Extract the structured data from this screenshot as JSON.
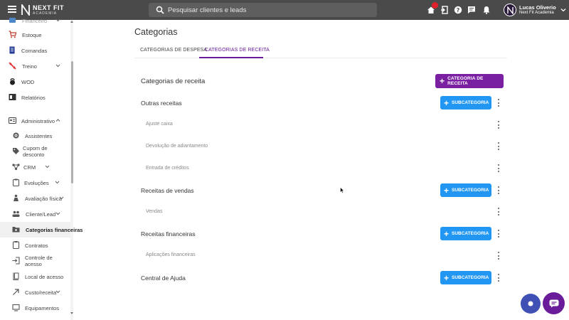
{
  "topbar": {
    "logo_line1": "NEXT FIT",
    "logo_line2": "ACADEMIA",
    "search_placeholder": "Pesquisar clientes e leads",
    "user_name": "Lucas Oliverio",
    "user_org": "Next Fit Academia",
    "icons": [
      "menu-icon",
      "home-icon",
      "logout-icon",
      "help-icon",
      "chat-icon",
      "bell-icon",
      "chevron-down-icon"
    ],
    "badge_color": "#e0202a"
  },
  "sidebar": {
    "items": [
      {
        "label": "Financeiro",
        "icon": "finance-icon"
      },
      {
        "label": "Estoque",
        "icon": "cart-icon"
      },
      {
        "label": "Comandas",
        "icon": "receipt-icon"
      },
      {
        "label": "Treino",
        "icon": "training-icon"
      },
      {
        "label": "WOD",
        "icon": "kettlebell-icon"
      },
      {
        "label": "Relatórios",
        "icon": "report-icon"
      },
      {
        "label": "Administrativo",
        "icon": "admin-icon"
      },
      {
        "label": "Assistentes",
        "icon": "gear-icon"
      },
      {
        "label": "Cupom de desconto",
        "icon": "tag-icon"
      },
      {
        "label": "CRM",
        "icon": "crm-icon"
      },
      {
        "label": "Evoluções",
        "icon": "clipboard-icon"
      },
      {
        "label": "Avaliação física",
        "icon": "person-icon"
      },
      {
        "label": "Cliente/Lead",
        "icon": "people-icon"
      },
      {
        "label": "Categorias financeiras",
        "icon": "folder-icon"
      },
      {
        "label": "Contratos",
        "icon": "contract-icon"
      },
      {
        "label": "Controle de acesso",
        "icon": "login-icon"
      },
      {
        "label": "Local de acesso",
        "icon": "door-icon"
      },
      {
        "label": "Custo/receita",
        "icon": "arrow-icon"
      },
      {
        "label": "Equipamentos",
        "icon": "equipment-icon"
      }
    ]
  },
  "main": {
    "title": "Categorias",
    "tabs": [
      {
        "label": "CATEGORIAS DE DESPESA"
      },
      {
        "label": "CATEGORIAS DE RECEITA"
      }
    ],
    "section_title": "Categorias de receita",
    "add_category_label": "CATEGORIA DE RECEITA",
    "add_sub_label": "SUBCATEGORIA",
    "categories": [
      {
        "name": "Outras receitas",
        "subs": [
          "Ajuste caixa",
          "Devolução de adiantamento",
          "Entrada de créditos"
        ]
      },
      {
        "name": "Receitas de vendas",
        "subs": [
          "Vendas"
        ]
      },
      {
        "name": "Receitas financeiras",
        "subs": [
          "Aplicações financeiras"
        ]
      },
      {
        "name": "Central de Ajuda",
        "subs": []
      }
    ]
  },
  "colors": {
    "topbar": "#4a4a4a",
    "accent_purple": "#7b1fa2",
    "accent_blue": "#2196f3",
    "fab_blue": "#3f51b5",
    "fab_purple": "#6a1b9a"
  }
}
